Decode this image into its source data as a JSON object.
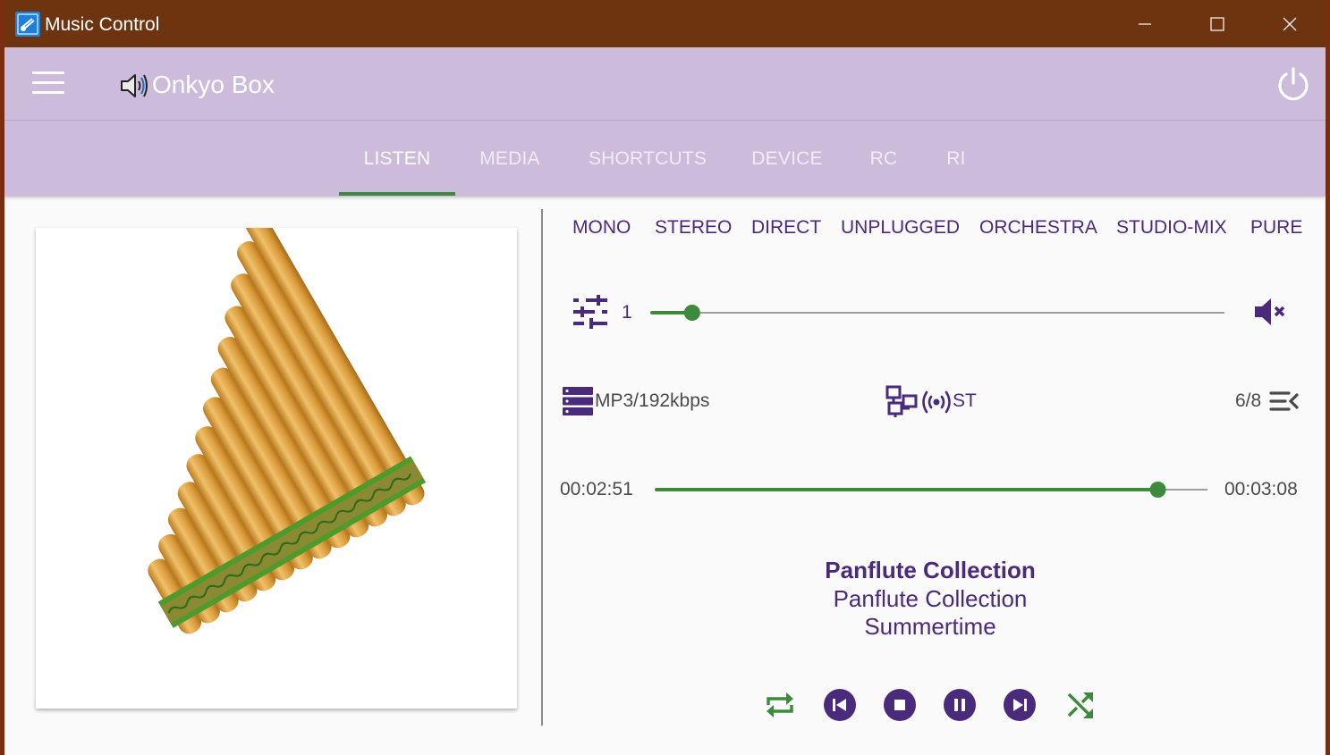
{
  "window": {
    "title": "Music Control",
    "accent": "#6e3410"
  },
  "header": {
    "device_name": "Onkyo Box",
    "bg_color": "#cdbbdc"
  },
  "tabs": [
    {
      "label": "LISTEN",
      "active": true
    },
    {
      "label": "MEDIA",
      "active": false
    },
    {
      "label": "SHORTCUTS",
      "active": false
    },
    {
      "label": "DEVICE",
      "active": false
    },
    {
      "label": "RC",
      "active": false
    },
    {
      "label": "RI",
      "active": false
    }
  ],
  "listening_modes": [
    "MONO",
    "STEREO",
    "DIRECT",
    "UNPLUGGED",
    "ORCHESTRA",
    "STUDIO-MIX",
    "PURE"
  ],
  "volume": {
    "value": "1",
    "level": 0.07,
    "muted": true
  },
  "info": {
    "format": "MP3/192kbps",
    "signal": "ST",
    "track_position": "6/8"
  },
  "progress": {
    "current": "00:02:51",
    "total": "00:03:08",
    "fraction": 0.91
  },
  "track": {
    "album": "Panflute Collection",
    "artist": "Panflute Collection",
    "title": "Summertime"
  },
  "controls": {
    "icons": [
      "repeat-icon",
      "previous-icon",
      "stop-icon",
      "pause-icon",
      "next-icon",
      "shuffle-icon"
    ]
  },
  "colors": {
    "purple": "#4a2a7a",
    "green": "#3c8a3c"
  }
}
